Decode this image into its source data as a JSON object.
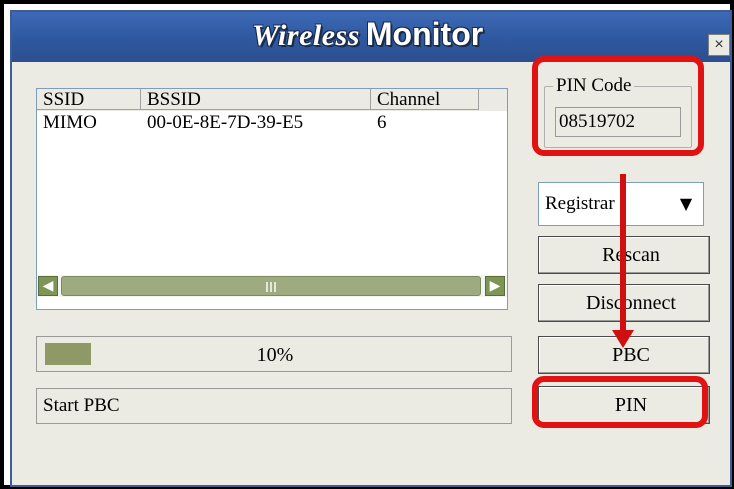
{
  "window": {
    "title_part1": "Wireless",
    "title_part2": "Monitor",
    "close_label": "×"
  },
  "network_list": {
    "columns": [
      "SSID",
      "BSSID",
      "Channel"
    ],
    "rows": [
      {
        "ssid": "MIMO",
        "bssid": "00-0E-8E-7D-39-E5",
        "channel": "6"
      }
    ],
    "scroll_left": "◀",
    "scroll_right": "▶"
  },
  "progress": {
    "value": 0.1,
    "label": "10%"
  },
  "status": {
    "text": "Start PBC"
  },
  "pin_group": {
    "title": "PIN Code",
    "value": "08519702"
  },
  "mode_select": {
    "value": "Registrar",
    "arrow": "▼"
  },
  "buttons": {
    "rescan": "Rescan",
    "disconnect": "Disconnect",
    "pbc": "PBC",
    "pin": "PIN"
  },
  "colors": {
    "annotation": "#e01212",
    "titlebar": "#2e589f",
    "progress_fill": "#8f9966"
  }
}
